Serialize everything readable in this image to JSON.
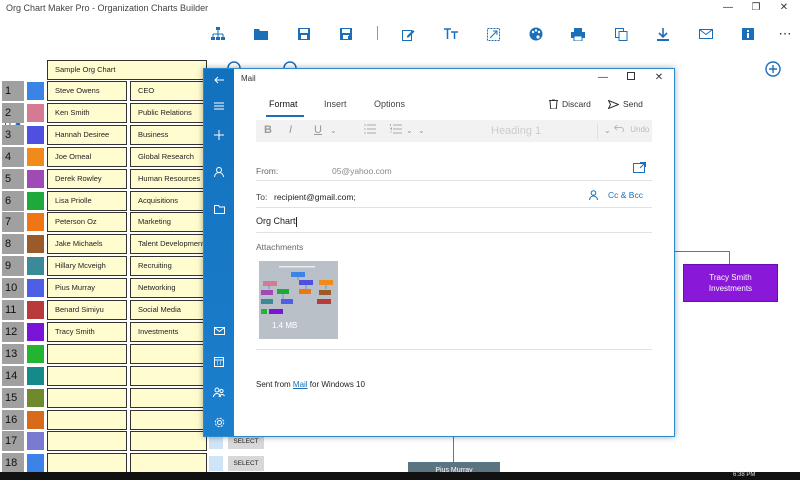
{
  "app": {
    "title": "Org Chart Maker Pro - Organization Charts Builder",
    "window_controls": [
      "—",
      "❐",
      "✕"
    ]
  },
  "toolbar": {
    "icons": [
      "org-chart-icon",
      "open-folder-icon",
      "save-icon",
      "save-as-icon",
      "edit-icon",
      "text-size-icon",
      "crop-icon",
      "palette-icon",
      "print-icon",
      "copy-icon",
      "download-icon",
      "mail-icon",
      "info-icon",
      "more-icon"
    ],
    "more_label": "⋯"
  },
  "grid": {
    "chart_title": "Sample Org Chart",
    "rows": [
      {
        "num": "1",
        "color": "#3b83e6",
        "name": "Steve Owens",
        "title": "CEO"
      },
      {
        "num": "2",
        "color": "#d67a93",
        "name": "Ken Smith",
        "title": "Public Relations"
      },
      {
        "num": "3",
        "color": "#4f4fe0",
        "name": "Hannah Desiree",
        "title": "Business"
      },
      {
        "num": "4",
        "color": "#f08a1a",
        "name": "Joe Omeal",
        "title": "Global Research"
      },
      {
        "num": "5",
        "color": "#a04bb5",
        "name": "Derek Rowley",
        "title": "Human Resources"
      },
      {
        "num": "6",
        "color": "#1eaa3a",
        "name": "Lisa Priolle",
        "title": "Acquisitions"
      },
      {
        "num": "7",
        "color": "#f07514",
        "name": "Peterson Oz",
        "title": "Marketing"
      },
      {
        "num": "8",
        "color": "#9b5a2a",
        "name": "Jake Michaels",
        "title": "Talent Development"
      },
      {
        "num": "9",
        "color": "#3a8a9a",
        "name": "Hillary Mcveigh",
        "title": "Recruiting"
      },
      {
        "num": "10",
        "color": "#4f5fe5",
        "name": "Pius Murray",
        "title": "Networking"
      },
      {
        "num": "11",
        "color": "#b83a3a",
        "name": "Benard Simiyu",
        "title": "Social Media"
      },
      {
        "num": "12",
        "color": "#7a14d8",
        "name": "Tracy Smith",
        "title": "Investments"
      },
      {
        "num": "13",
        "color": "#22b432",
        "name": "",
        "title": ""
      },
      {
        "num": "14",
        "color": "#148a8a",
        "name": "",
        "title": ""
      },
      {
        "num": "15",
        "color": "#6f8a2a",
        "name": "",
        "title": ""
      },
      {
        "num": "16",
        "color": "#d86a1a",
        "name": "",
        "title": ""
      },
      {
        "num": "17",
        "color": "#7a7ad0",
        "name": "",
        "title": ""
      },
      {
        "num": "18",
        "color": "#3b83e6",
        "name": "",
        "title": ""
      }
    ],
    "select_label": "SELECT"
  },
  "canvas": {
    "node_right": "Tracy Smith\nInvestments",
    "node_bottom": "Pius Murray",
    "node_right_color": "#8a18d8",
    "node_bottom_color": "#5a7482"
  },
  "mail": {
    "title": "Mail",
    "tabs": [
      "Format",
      "Insert",
      "Options"
    ],
    "discard": "Discard",
    "send": "Send",
    "format_buttons": [
      "B",
      "I",
      "U"
    ],
    "heading_placeholder": "Heading 1",
    "undo": "Undo",
    "from_label": "From:",
    "from_value": "05@yahoo.com",
    "to_label": "To:",
    "to_value": "recipient@gmail.com;",
    "cc_bcc": "Cc & Bcc",
    "subject": "Org Chart",
    "attachments_label": "Attachments",
    "attachment_size": "1.4 MB",
    "sig_prefix": "Sent from ",
    "sig_link": "Mail",
    "sig_suffix": " for Windows 10",
    "accent": "#1a6fb8"
  },
  "taskbar": {
    "time": "6:38 PM"
  }
}
